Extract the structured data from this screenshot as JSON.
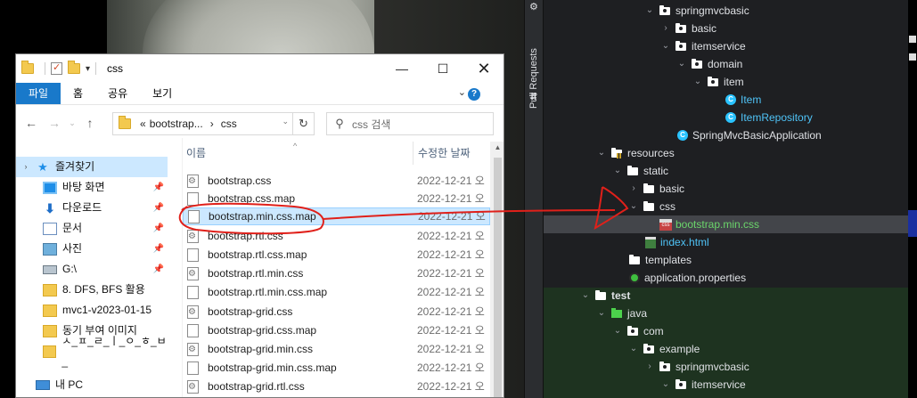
{
  "explorer": {
    "window_title": "css",
    "ribbon_tabs": [
      "파일",
      "홈",
      "공유",
      "보기"
    ],
    "address_parts": [
      "«",
      "bootstrap...",
      "›",
      "css"
    ],
    "search_placeholder": "css 검색",
    "column_name": "이름",
    "column_modified": "수정한 날짜",
    "nav_items": [
      {
        "label": "즐겨찾기",
        "icon": "star-icon"
      },
      {
        "label": "바탕 화면",
        "icon": "desktop-icon"
      },
      {
        "label": "다운로드",
        "icon": "download-icon"
      },
      {
        "label": "문서",
        "icon": "document-icon"
      },
      {
        "label": "사진",
        "icon": "pictures-icon"
      },
      {
        "label": "G:\\",
        "icon": "drive-icon"
      },
      {
        "label": "8. DFS, BFS 활용",
        "icon": "folder-icon"
      },
      {
        "label": "mvc1-v2023-01-15",
        "icon": "folder-icon"
      },
      {
        "label": "동기 부여 이미지",
        "icon": "folder-icon"
      },
      {
        "label": "ㅅ_ㅍ_ㄹ_ㅣ_ㅇ_ㅎ_ㅂ_",
        "icon": "folder-icon"
      },
      {
        "label": "내 PC",
        "icon": "pc-icon"
      }
    ],
    "files": [
      {
        "name": "bootstrap.css",
        "date": "2022-12-21 오"
      },
      {
        "name": "bootstrap.css.map",
        "date": "2022-12-21 오"
      },
      {
        "name": "bootstrap.min.css.map",
        "date": "2022-12-21 오"
      },
      {
        "name": "bootstrap.rtl.css",
        "date": "2022-12-21 오"
      },
      {
        "name": "bootstrap.rtl.css.map",
        "date": "2022-12-21 오"
      },
      {
        "name": "bootstrap.rtl.min.css",
        "date": "2022-12-21 오"
      },
      {
        "name": "bootstrap.rtl.min.css.map",
        "date": "2022-12-21 오"
      },
      {
        "name": "bootstrap-grid.css",
        "date": "2022-12-21 오"
      },
      {
        "name": "bootstrap-grid.css.map",
        "date": "2022-12-21 오"
      },
      {
        "name": "bootstrap-grid.min.css",
        "date": "2022-12-21 오"
      },
      {
        "name": "bootstrap-grid.min.css.map",
        "date": "2022-12-21 오"
      },
      {
        "name": "bootstrap-grid.rtl.css",
        "date": "2022-12-21 오"
      }
    ]
  },
  "ide": {
    "side_tab": "Pull Requests",
    "tree": [
      {
        "label": "springmvcbasic",
        "icon": "package",
        "chevron": "down"
      },
      {
        "label": "basic",
        "icon": "package",
        "chevron": "right"
      },
      {
        "label": "itemservice",
        "icon": "package",
        "chevron": "down"
      },
      {
        "label": "domain",
        "icon": "package",
        "chevron": "down"
      },
      {
        "label": "item",
        "icon": "package",
        "chevron": "down"
      },
      {
        "label": "Item",
        "icon": "class",
        "chevron": ""
      },
      {
        "label": "ItemRepository",
        "icon": "class",
        "chevron": ""
      },
      {
        "label": "SpringMvcBasicApplication",
        "icon": "spring-class",
        "chevron": ""
      },
      {
        "label": "resources",
        "icon": "resources",
        "chevron": "down"
      },
      {
        "label": "static",
        "icon": "folder",
        "chevron": "down"
      },
      {
        "label": "basic",
        "icon": "folder",
        "chevron": "right"
      },
      {
        "label": "css",
        "icon": "folder",
        "chevron": "down"
      },
      {
        "label": "bootstrap.min.css",
        "icon": "css-file",
        "chevron": ""
      },
      {
        "label": "index.html",
        "icon": "html-file",
        "chevron": ""
      },
      {
        "label": "templates",
        "icon": "folder",
        "chevron": ""
      },
      {
        "label": "application.properties",
        "icon": "properties-file",
        "chevron": ""
      },
      {
        "label": "test",
        "icon": "test-folder",
        "chevron": "down"
      },
      {
        "label": "java",
        "icon": "test-source",
        "chevron": "down"
      },
      {
        "label": "com",
        "icon": "package",
        "chevron": "down"
      },
      {
        "label": "example",
        "icon": "package",
        "chevron": "down"
      },
      {
        "label": "springmvcbasic",
        "icon": "package",
        "chevron": "right"
      },
      {
        "label": "itemservice",
        "icon": "package",
        "chevron": "down"
      }
    ]
  },
  "colors": {
    "ide_bg": "#1e1f22",
    "test_bg": "#1e3320",
    "class_text": "#4fc3f7",
    "css_file_text": "#6bd66b",
    "annotation_red": "#e0201a",
    "explorer_accent": "#1979ca"
  }
}
